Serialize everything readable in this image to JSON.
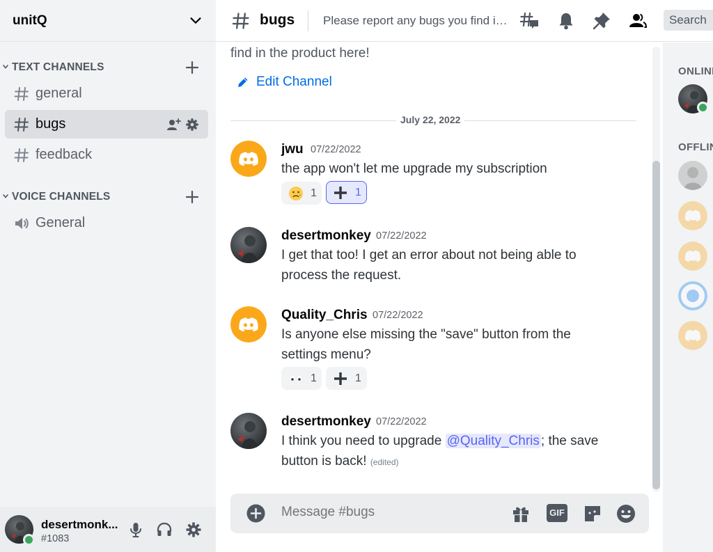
{
  "server": {
    "name": "unitQ"
  },
  "categories": {
    "text": {
      "label": "TEXT CHANNELS"
    },
    "voice": {
      "label": "VOICE CHANNELS"
    }
  },
  "channels": [
    {
      "name": "general",
      "type": "text",
      "selected": false
    },
    {
      "name": "bugs",
      "type": "text",
      "selected": true
    },
    {
      "name": "feedback",
      "type": "text",
      "selected": false
    },
    {
      "name": "General",
      "type": "voice",
      "selected": false
    }
  ],
  "user": {
    "name": "desertmonk...",
    "tag": "#1083",
    "status": "online"
  },
  "topbar": {
    "channel": "bugs",
    "topic": "Please report any bugs you find in the product here!",
    "search_placeholder": "Search"
  },
  "chat": {
    "intro_text": "find in the product here!",
    "edit_channel_label": "Edit Channel",
    "date_divider": "July 22, 2022",
    "messages": [
      {
        "author": "jwu",
        "timestamp": "07/22/2022",
        "avatar": "discord-default-orange",
        "text": "the app won't let me upgrade my subscription",
        "reactions": [
          {
            "emoji": "crying-face",
            "count": "1",
            "active": false
          },
          {
            "emoji": "plus-sign",
            "count": "1",
            "active": true
          }
        ]
      },
      {
        "author": "desertmonkey",
        "timestamp": "07/22/2022",
        "avatar": "dark-photo",
        "text": "I get that too! I get an error about not being able to process the request.",
        "reactions": []
      },
      {
        "author": "Quality_Chris",
        "timestamp": "07/22/2022",
        "avatar": "discord-default-orange",
        "text": "Is anyone else missing the \"save\" button from the settings menu?",
        "reactions": [
          {
            "emoji": "eyes",
            "count": "1",
            "active": false
          },
          {
            "emoji": "plus-sign",
            "count": "1",
            "active": false
          }
        ]
      },
      {
        "author": "desertmonkey",
        "timestamp": "07/22/2022",
        "avatar": "dark-photo",
        "text_before": "I think you need to upgrade ",
        "mention": "@Quality_Chris",
        "text_after": "; the save button is back!",
        "edited_label": "(edited)",
        "reactions": []
      }
    ]
  },
  "composer": {
    "placeholder": "Message #bugs",
    "gif_label": "GIF"
  },
  "members": {
    "online_heading": "ONLINE",
    "offline_heading": "OFFLINE"
  },
  "colors": {
    "accent": "#5865f2",
    "link": "#006ce7",
    "online": "#3ba55d",
    "discord_orange": "#faa81a"
  }
}
